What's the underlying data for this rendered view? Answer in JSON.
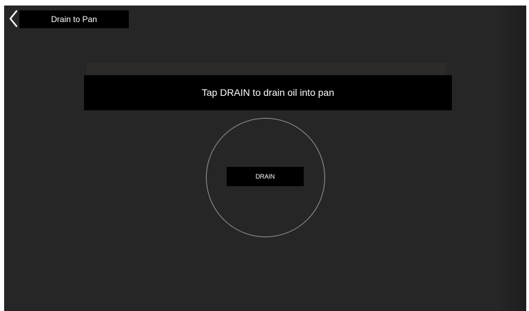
{
  "header": {
    "title": "Drain to Pan",
    "back_icon": "chevron-left-icon"
  },
  "main": {
    "instruction": "Tap DRAIN to drain oil into pan",
    "drain_label": "DRAIN"
  },
  "colors": {
    "background": "#262626",
    "panel": "#000000",
    "text": "#ffffff",
    "ring": "#9a9a9a"
  }
}
